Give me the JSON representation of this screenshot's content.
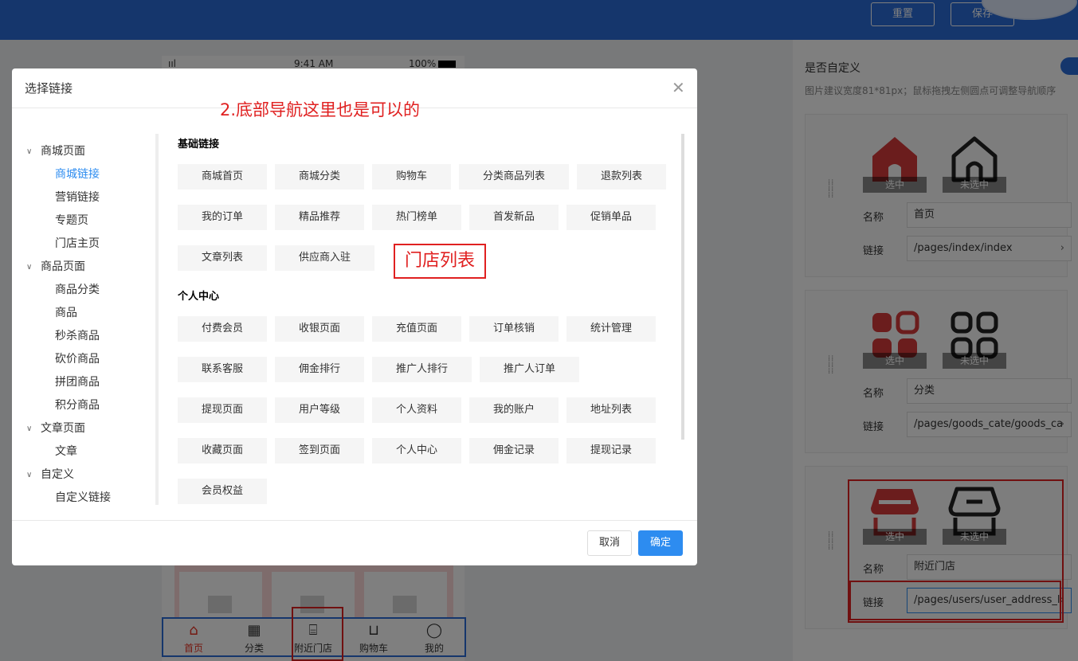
{
  "topbar": {
    "reset_label": "重置",
    "save_label": "保存"
  },
  "phone": {
    "signal": "ııl",
    "time": "9:41 AM",
    "battery": "100%"
  },
  "tabbar": {
    "items": [
      {
        "label": "首页",
        "icon": "home-icon",
        "glyph": "⌂"
      },
      {
        "label": "分类",
        "icon": "grid-icon",
        "glyph": "▦"
      },
      {
        "label": "附近门店",
        "icon": "store-icon",
        "glyph": "⌸"
      },
      {
        "label": "购物车",
        "icon": "cart-icon",
        "glyph": "⊔"
      },
      {
        "label": "我的",
        "icon": "user-icon",
        "glyph": "◯"
      }
    ]
  },
  "right_panel": {
    "title": "是否自定义",
    "hint": "图片建议宽度81*81px；鼠标拖拽左侧圆点可调整导航顺序",
    "selected_label": "选中",
    "unselected_label": "未选中",
    "name_label": "名称",
    "link_label": "链接",
    "cards": [
      {
        "name": "首页",
        "link": "/pages/index/index",
        "icon": "home-icon"
      },
      {
        "name": "分类",
        "link": "/pages/goods_cate/goods_ca",
        "icon": "category-icon"
      },
      {
        "name": "附近门店",
        "link": "/pages/users/user_address_l",
        "icon": "store-icon"
      }
    ]
  },
  "modal": {
    "title": "选择链接",
    "annotation_title": "2.底部导航这里也是可以的",
    "annotation_box": "门店列表",
    "tree": [
      {
        "label": "商城页面",
        "children": [
          "商城链接",
          "营销链接",
          "专题页",
          "门店主页"
        ]
      },
      {
        "label": "商品页面",
        "children": [
          "商品分类",
          "商品",
          "秒杀商品",
          "砍价商品",
          "拼团商品",
          "积分商品"
        ]
      },
      {
        "label": "文章页面",
        "children": [
          "文章"
        ]
      },
      {
        "label": "自定义",
        "children": [
          "自定义链接"
        ]
      }
    ],
    "active_tree_item": "商城链接",
    "sections": [
      {
        "title": "基础链接",
        "links": [
          "商城首页",
          "商城分类",
          "购物车",
          "分类商品列表",
          "退款列表",
          "我的订单",
          "精品推荐",
          "热门榜单",
          "首发新品",
          "促销单品",
          "文章列表",
          "供应商入驻"
        ]
      },
      {
        "title": "个人中心",
        "links": [
          "付费会员",
          "收银页面",
          "充值页面",
          "订单核销",
          "统计管理",
          "联系客服",
          "佣金排行",
          "推广人排行",
          "推广人订单",
          "提现页面",
          "用户等级",
          "个人资料",
          "我的账户",
          "地址列表",
          "收藏页面",
          "签到页面",
          "个人中心",
          "佣金记录",
          "提现记录",
          "会员权益"
        ]
      }
    ],
    "cancel_label": "取消",
    "ok_label": "确定"
  },
  "colors": {
    "brand": "#2b6dd8",
    "accent": "#2d8cf0",
    "highlight": "#e02020",
    "active_tab": "#e93323"
  }
}
